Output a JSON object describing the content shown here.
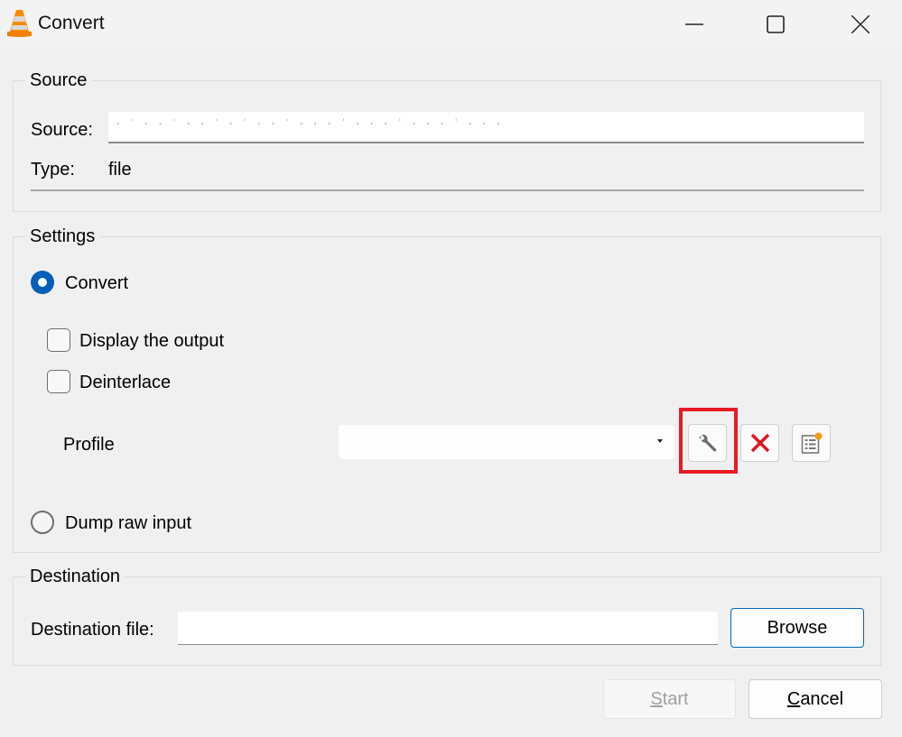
{
  "window": {
    "title": "Convert",
    "icon": "vlc-cone-icon",
    "controls": {
      "minimize": "minimize-icon",
      "maximize": "maximize-icon",
      "close": "close-icon"
    }
  },
  "source_group": {
    "label": "Source",
    "source_label": "Source:",
    "source_value": "C:\\Users\\...\\OneDrive\\Desktop\\Video.mp4 (blurred)",
    "type_label": "Type:",
    "type_value": "file"
  },
  "settings_group": {
    "label": "Settings",
    "convert_radio": {
      "label": "Convert",
      "checked": true
    },
    "display_output": {
      "label": "Display the output",
      "checked": false
    },
    "deinterlace": {
      "label": "Deinterlace",
      "checked": false
    },
    "profile_label": "Profile",
    "profile_value": "",
    "profile_buttons": [
      {
        "name": "edit-profile",
        "icon": "wrench-icon",
        "highlighted": true
      },
      {
        "name": "delete-profile",
        "icon": "red-x-icon"
      },
      {
        "name": "new-profile",
        "icon": "new-list-icon"
      }
    ],
    "dump_raw_radio": {
      "label": "Dump raw input",
      "checked": false
    }
  },
  "destination_group": {
    "label": "Destination",
    "file_label": "Destination file:",
    "file_value": "",
    "browse_label": "Browse"
  },
  "footer": {
    "start": {
      "mnemonic": "S",
      "rest": "tart",
      "enabled": false
    },
    "cancel": {
      "mnemonic": "C",
      "rest": "ancel",
      "enabled": true
    }
  },
  "colors": {
    "accent": "#005fb8",
    "highlight_box": "#e81b23",
    "delete_red": "#e0141e",
    "vlc_orange": "#f58b00"
  }
}
